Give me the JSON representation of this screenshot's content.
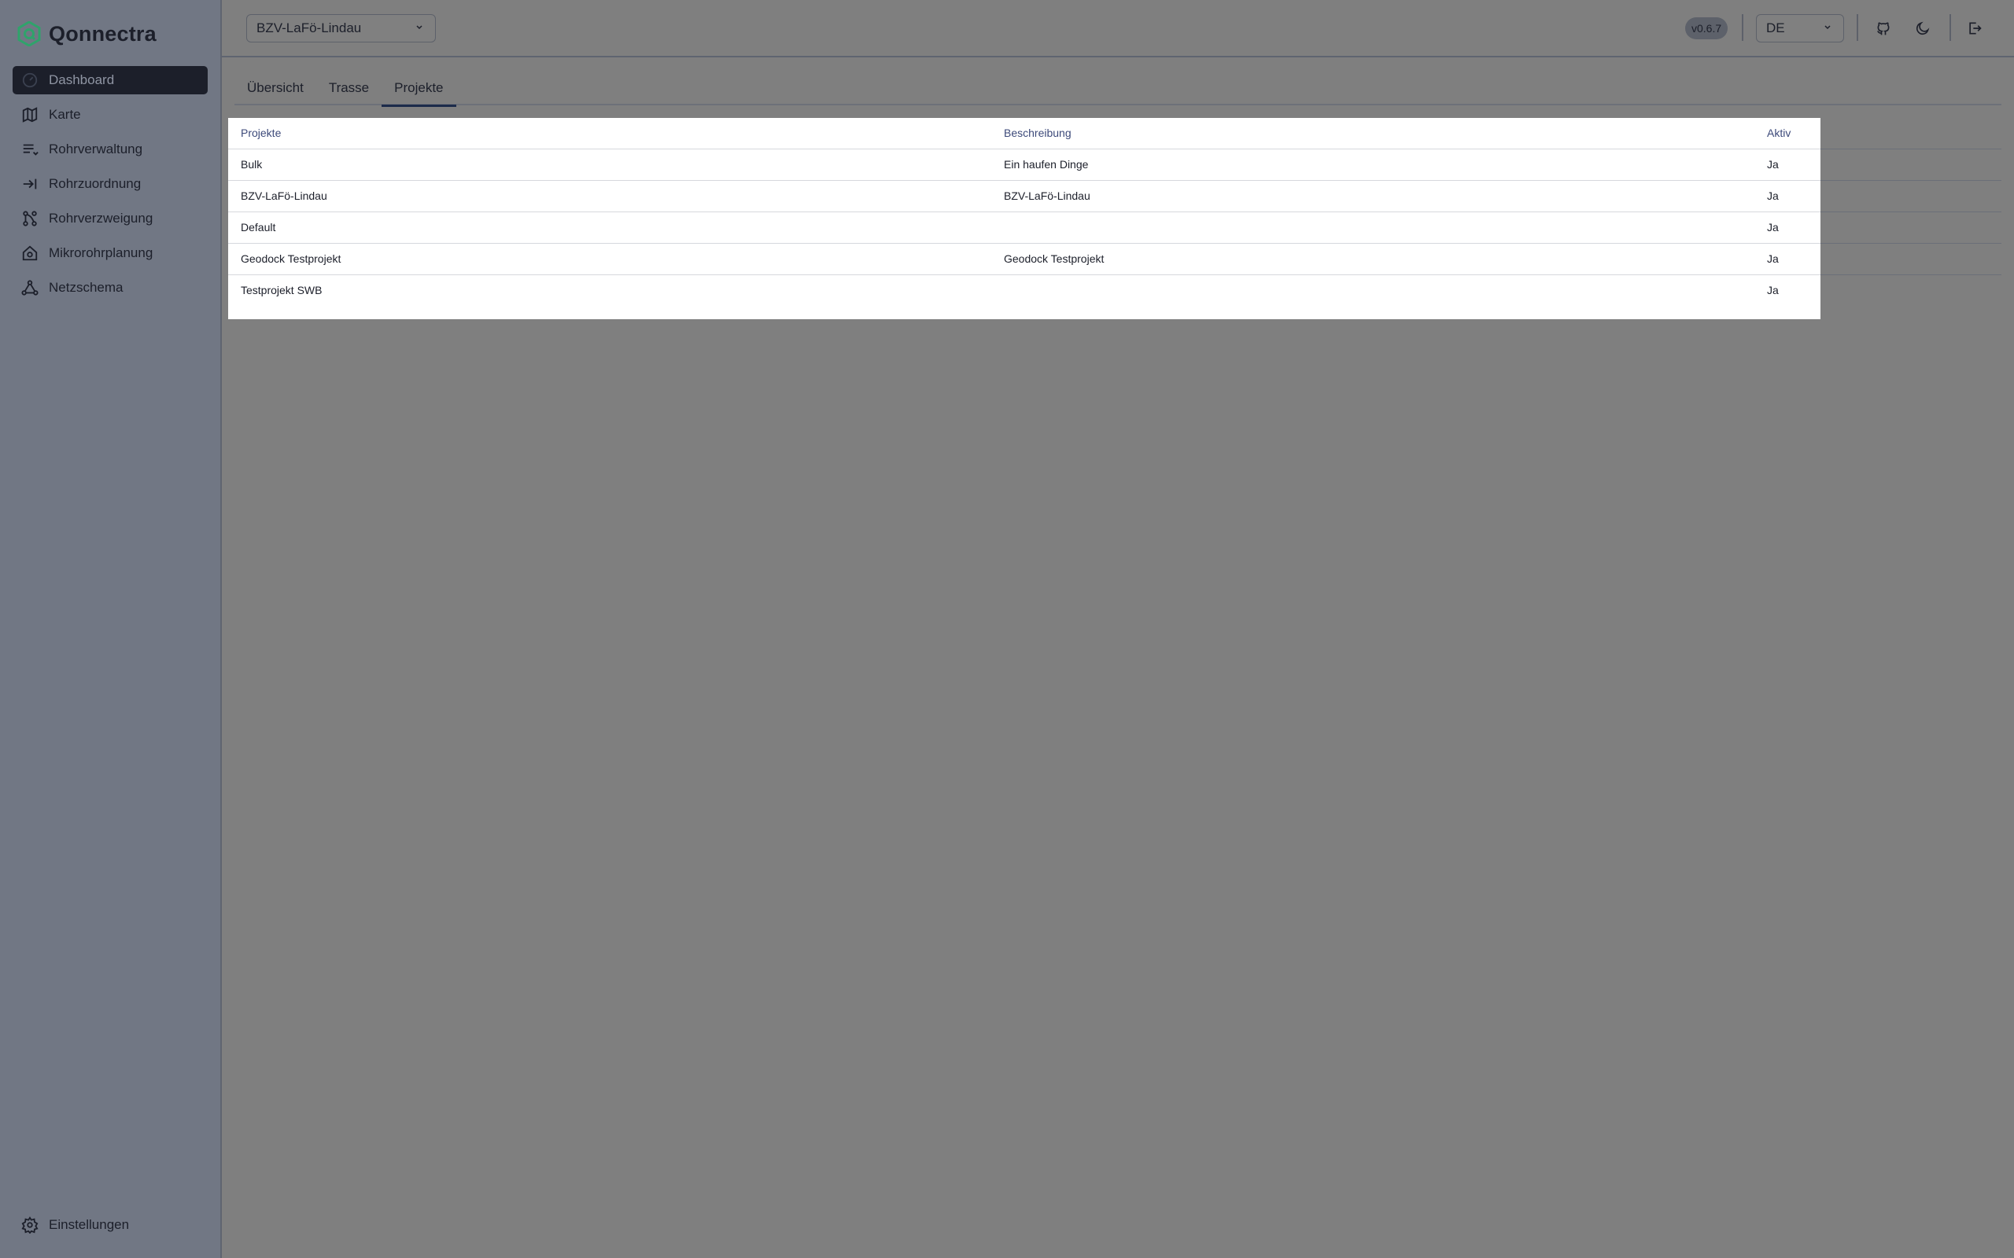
{
  "app": {
    "name": "Qonnectra",
    "accent_color": "#2fa36b"
  },
  "sidebar": {
    "items": [
      {
        "label": "Dashboard",
        "icon": "dashboard-icon",
        "active": true
      },
      {
        "label": "Karte",
        "icon": "map-icon"
      },
      {
        "label": "Rohrverwaltung",
        "icon": "list-icon"
      },
      {
        "label": "Rohrzuordnung",
        "icon": "arrow-right-bar-icon"
      },
      {
        "label": "Rohrverzweigung",
        "icon": "branch-icon"
      },
      {
        "label": "Mikrorohrplanung",
        "icon": "home-icon"
      },
      {
        "label": "Netzschema",
        "icon": "network-icon"
      }
    ],
    "settings_label": "Einstellungen"
  },
  "header": {
    "project_selected": "BZV-LaFö-Lindau",
    "version": "v0.6.7",
    "language": "DE",
    "icons": [
      "github-icon",
      "moon-icon",
      "logout-icon"
    ]
  },
  "tabs": [
    {
      "label": "Übersicht"
    },
    {
      "label": "Trasse"
    },
    {
      "label": "Projekte",
      "active": true
    }
  ],
  "table": {
    "headers": [
      "Projekte",
      "Beschreibung",
      "Aktiv"
    ],
    "rows": [
      [
        "Bulk",
        "Ein haufen Dinge",
        "Ja"
      ],
      [
        "BZV-LaFö-Lindau",
        "BZV-LaFö-Lindau",
        "Ja"
      ],
      [
        "Default",
        "",
        "Ja"
      ],
      [
        "Geodock Testprojekt",
        "Geodock Testprojekt",
        "Ja"
      ],
      [
        "Testprojekt SWB",
        "",
        "Ja"
      ]
    ]
  }
}
